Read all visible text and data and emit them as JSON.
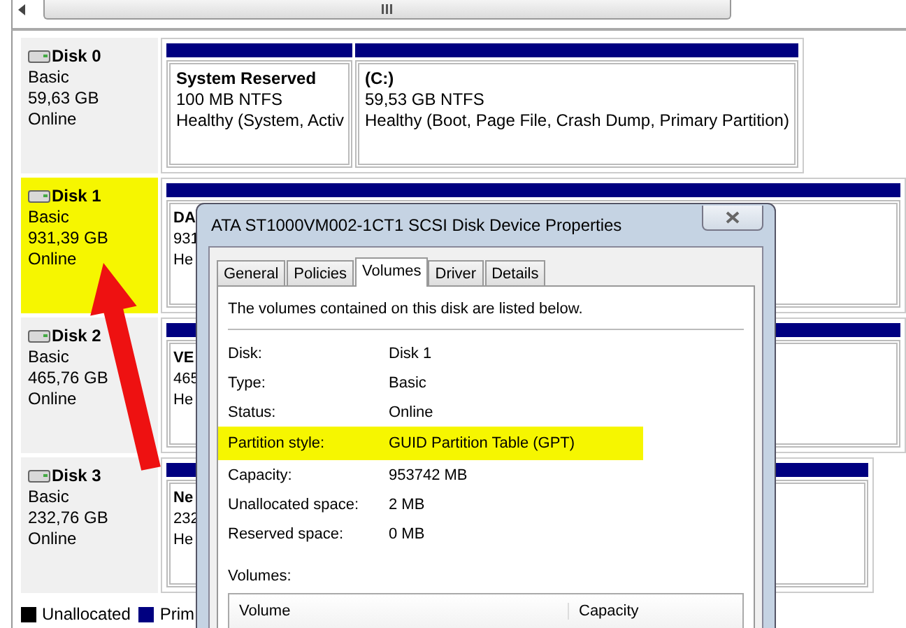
{
  "disks": [
    {
      "name": "Disk 0",
      "type": "Basic",
      "size": "59,63 GB",
      "status": "Online",
      "highlighted": false,
      "partitions": [
        {
          "name": "System Reserved",
          "detail": "100 MB NTFS",
          "health": "Healthy (System, Activ"
        },
        {
          "name": "(C:)",
          "detail": "59,53 GB NTFS",
          "health": "Healthy (Boot, Page File, Crash Dump, Primary Partition)"
        }
      ]
    },
    {
      "name": "Disk 1",
      "type": "Basic",
      "size": "931,39 GB",
      "status": "Online",
      "highlighted": true,
      "partitions": [
        {
          "name": "DA",
          "detail": "931",
          "health": "He"
        }
      ]
    },
    {
      "name": "Disk 2",
      "type": "Basic",
      "size": "465,76 GB",
      "status": "Online",
      "highlighted": false,
      "partitions": [
        {
          "name": "VE",
          "detail": "465",
          "health": "He"
        }
      ]
    },
    {
      "name": "Disk 3",
      "type": "Basic",
      "size": "232,76 GB",
      "status": "Online",
      "highlighted": false,
      "partitions": [
        {
          "name": "Ne",
          "detail": "232",
          "health": "He"
        }
      ]
    }
  ],
  "legend": [
    {
      "label": "Unallocated",
      "color": "#000000"
    },
    {
      "label": "Prim",
      "color": "#000080"
    }
  ],
  "dialog": {
    "title": "ATA ST1000VM002-1CT1 SCSI Disk Device Properties",
    "tabs": [
      {
        "label": "General",
        "selected": false
      },
      {
        "label": "Policies",
        "selected": false
      },
      {
        "label": "Volumes",
        "selected": true
      },
      {
        "label": "Driver",
        "selected": false
      },
      {
        "label": "Details",
        "selected": false
      }
    ],
    "intro": "The volumes contained on this disk are listed below.",
    "fields": [
      {
        "label": "Disk:",
        "value": "Disk 1",
        "highlighted": false
      },
      {
        "label": "Type:",
        "value": "Basic",
        "highlighted": false
      },
      {
        "label": "Status:",
        "value": "Online",
        "highlighted": false
      },
      {
        "label": "Partition style:",
        "value": "GUID Partition Table (GPT)",
        "highlighted": true
      },
      {
        "label": "Capacity:",
        "value": "953742 MB",
        "highlighted": false
      },
      {
        "label": "Unallocated space:",
        "value": "2 MB",
        "highlighted": false
      },
      {
        "label": "Reserved space:",
        "value": "0 MB",
        "highlighted": false
      }
    ],
    "volumes_label": "Volumes:",
    "volume_columns": [
      "Volume",
      "Capacity"
    ]
  }
}
